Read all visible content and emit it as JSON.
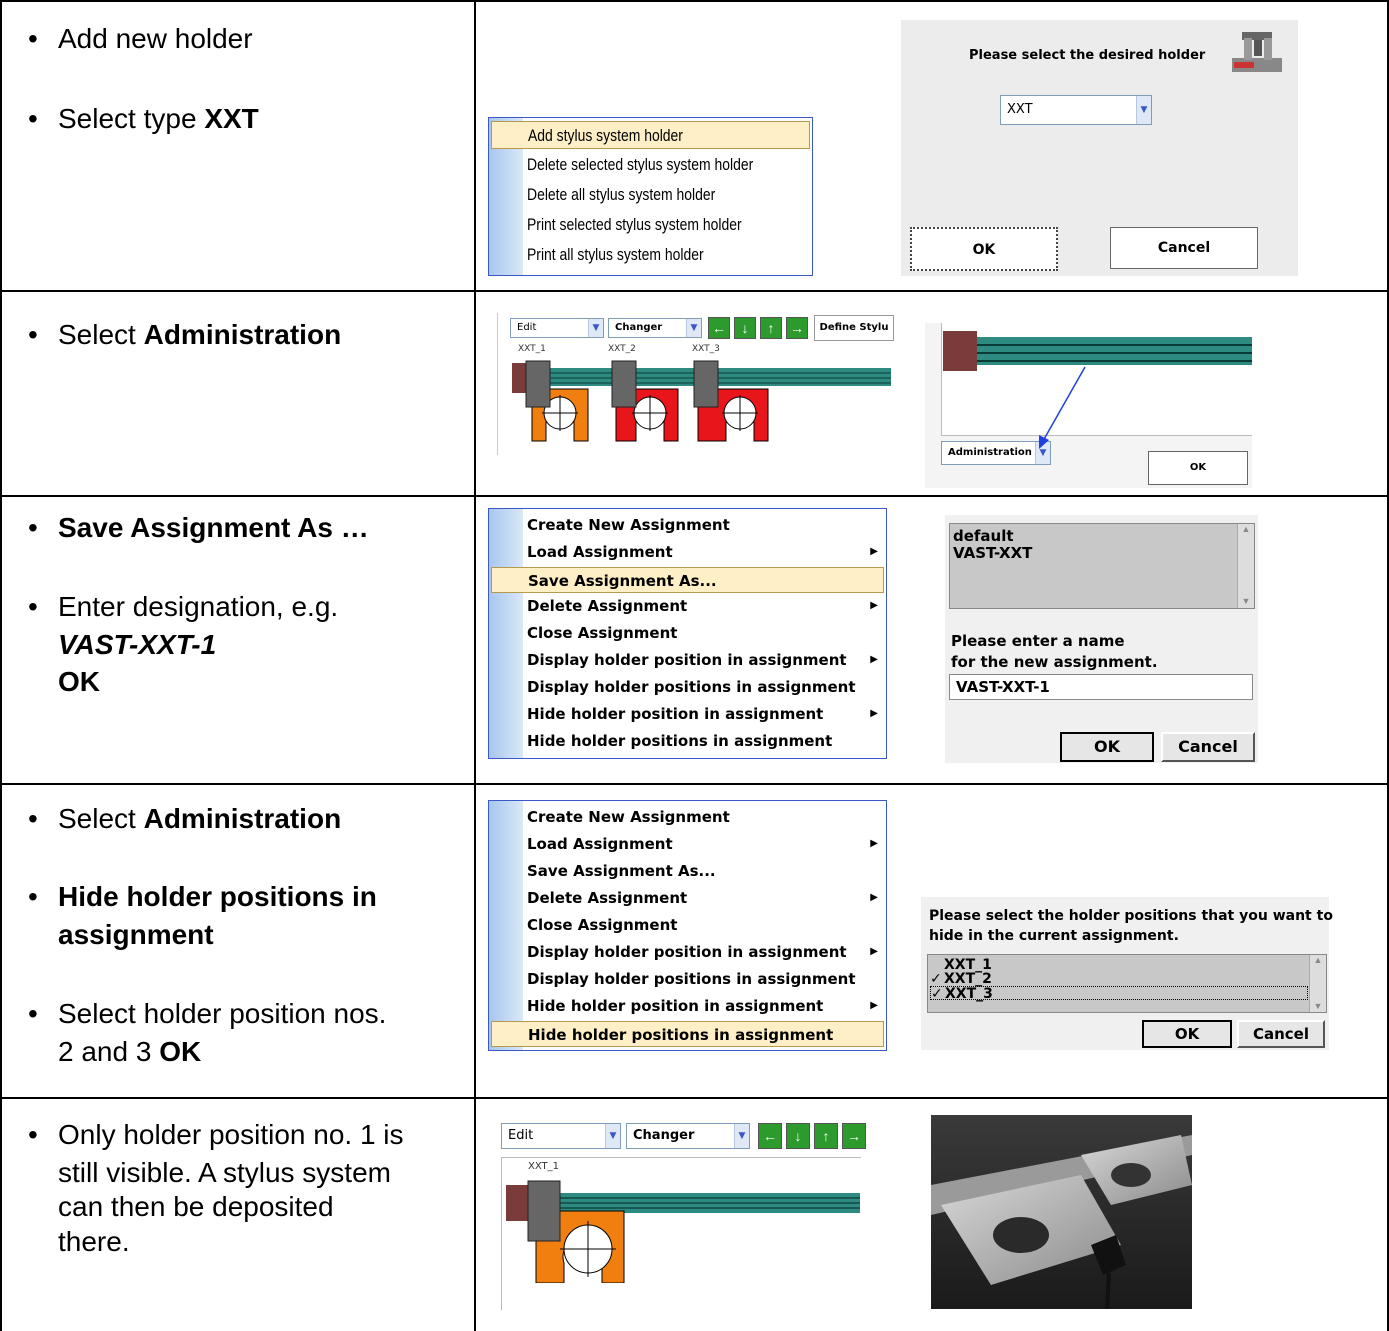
{
  "rows": [
    {
      "steps": [
        {
          "parts": [
            {
              "t": "Add new holder",
              "s": ""
            }
          ]
        },
        {
          "parts": [
            {
              "t": "Select type ",
              "s": ""
            },
            {
              "t": "XXT",
              "s": "b"
            }
          ]
        }
      ],
      "menu_items": [
        "Add stylus system holder",
        "Delete selected stylus system holder",
        "Delete all stylus system holder",
        "Print selected stylus system holder",
        "Print all stylus system holder"
      ],
      "dialog": {
        "prompt": "Please select the desired holder",
        "combo_value": "XXT",
        "ok": "OK",
        "cancel": "Cancel"
      }
    },
    {
      "steps": [
        {
          "parts": [
            {
              "t": "Select ",
              "s": ""
            },
            {
              "t": "Administration",
              "s": "b"
            }
          ]
        }
      ],
      "toolbar": {
        "edit": "Edit",
        "changer": "Changer",
        "define": "Define Stylu"
      },
      "holder_labels": [
        "XXT_1",
        "XXT_2",
        "XXT_3"
      ],
      "admin": {
        "combo": "Administration",
        "ok": "OK"
      }
    },
    {
      "steps": [
        {
          "parts": [
            {
              "t": "Save Assignment As …",
              "s": "b"
            }
          ]
        },
        {
          "parts": [
            {
              "t": "Enter designation, e.g.",
              "s": ""
            }
          ]
        },
        {
          "parts": [
            {
              "t": "VAST-XXT-1",
              "s": "bi"
            }
          ]
        },
        {
          "parts": [
            {
              "t": "OK",
              "s": "b"
            }
          ]
        }
      ],
      "menu_items": [
        "Create New Assignment",
        "Load Assignment",
        "Save Assignment As...",
        "Delete Assignment",
        "Close Assignment",
        "Display holder position in assignment",
        "Display holder positions in assignment",
        "Hide holder position in assignment",
        "Hide holder positions in assignment"
      ],
      "list": [
        "default",
        "VAST-XXT"
      ],
      "prompt": [
        "Please enter a name",
        "for the new assignment."
      ],
      "input": "VAST-XXT-1",
      "ok": "OK",
      "cancel": "Cancel"
    },
    {
      "steps": [
        {
          "parts": [
            {
              "t": "Select ",
              "s": ""
            },
            {
              "t": "Administration",
              "s": "b"
            }
          ]
        },
        {
          "parts": [
            {
              "t": "Hide holder positions in",
              "s": "b"
            }
          ]
        },
        {
          "parts": [
            {
              "t": "assignment",
              "s": "b"
            }
          ]
        },
        {
          "parts": [
            {
              "t": "Select holder position nos.",
              "s": ""
            }
          ]
        },
        {
          "parts": [
            {
              "t": "2 and 3  ",
              "s": ""
            },
            {
              "t": "OK",
              "s": "b"
            }
          ]
        }
      ],
      "menu_items": [
        "Create New Assignment",
        "Load Assignment",
        "Save Assignment As...",
        "Delete Assignment",
        "Close Assignment",
        "Display holder position in assignment",
        "Display holder positions in assignment",
        "Hide holder position in assignment",
        "Hide holder positions in assignment"
      ],
      "prompt": [
        "Please select the holder positions that you want to",
        "hide in the current assignment."
      ],
      "list": [
        {
          "label": "XXT_1",
          "checked": false
        },
        {
          "label": "XXT_2",
          "checked": true
        },
        {
          "label": "XXT_3",
          "checked": true
        }
      ],
      "ok": "OK",
      "cancel": "Cancel"
    },
    {
      "steps": [
        {
          "parts": [
            {
              "t": "Only holder position no. 1 is",
              "s": ""
            }
          ]
        },
        {
          "parts": [
            {
              "t": "still visible. A stylus system",
              "s": ""
            }
          ]
        },
        {
          "parts": [
            {
              "t": "can then be deposited",
              "s": ""
            }
          ]
        },
        {
          "parts": [
            {
              "t": "there.",
              "s": ""
            }
          ]
        }
      ],
      "toolbar": {
        "edit": "Edit",
        "changer": "Changer"
      },
      "holder_labels": [
        "XXT_1"
      ]
    }
  ],
  "colors": {
    "menu_highlight": "#ffefc6",
    "menu_gutter": "#a8c6ee",
    "rail": "#2e8b82",
    "holder_orange": "#f07f10",
    "holder_red": "#e8151b",
    "stylus_gray": "#666666",
    "mount": "#7a3b3b"
  },
  "icons": [
    "check-icon",
    "arrow-left-icon",
    "arrow-down-icon",
    "arrow-up-icon",
    "arrow-right-icon",
    "dropdown-arrow-icon",
    "submenu-arrow-icon",
    "machine-icon",
    "crosshair-icon"
  ]
}
